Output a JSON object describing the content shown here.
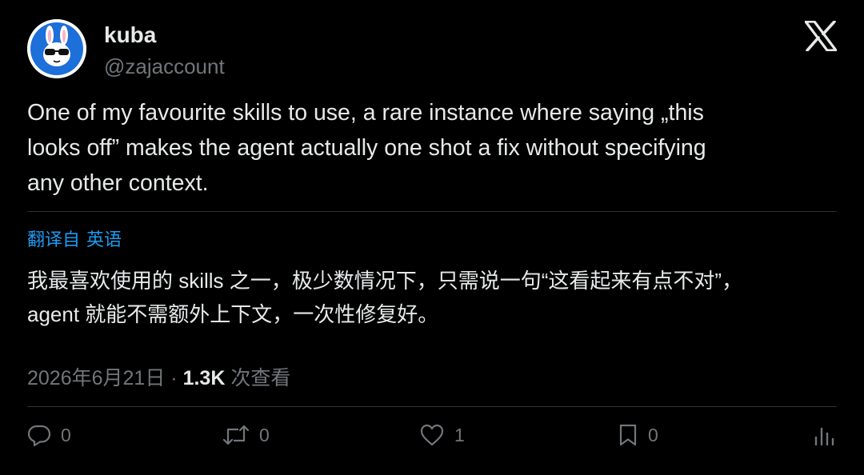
{
  "header": {
    "display_name": "kuba",
    "handle": "@zajaccount",
    "avatar_icon": "bunny-sunglasses-avatar",
    "platform_icon": "x-logo-icon"
  },
  "tweet": {
    "lines": [
      "One of my favourite skills to use, a rare instance where saying „this",
      "looks off” makes the agent actually one shot a fix without specifying",
      "any other context."
    ]
  },
  "translation": {
    "translated_from_label": "翻译自",
    "language_label": "英语",
    "lines": [
      "我最喜欢使用的 skills 之一，极少数情况下，只需说一句“这看起来有点不对”，",
      "agent 就能不需额外上下文，一次性修复好。"
    ]
  },
  "meta": {
    "date": "2026年6月21日",
    "separator": "·",
    "views_count": "1.3K",
    "views_label": "次查看"
  },
  "actions": {
    "reply_count": "0",
    "retweet_count": "0",
    "like_count": "1",
    "bookmark_count": "0"
  },
  "colors": {
    "background": "#000000",
    "text_primary": "#e7e9ea",
    "text_secondary": "#71767b",
    "accent_blue": "#1d9bf0",
    "divider": "#2f3336"
  }
}
